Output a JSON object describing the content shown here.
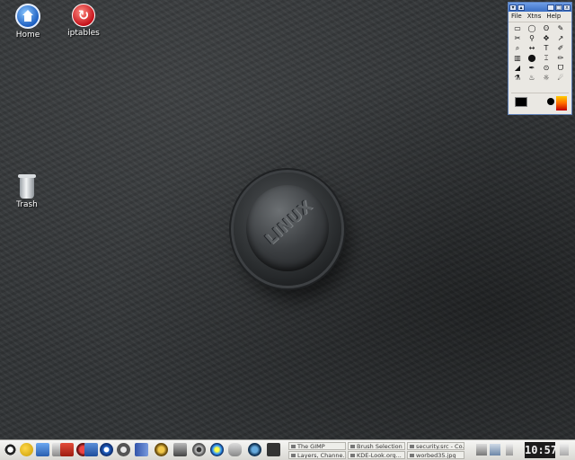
{
  "desktop": {
    "icons": [
      {
        "label": "Home"
      },
      {
        "label": "iptables"
      },
      {
        "label": "Trash"
      }
    ],
    "logo_text": "LINUX"
  },
  "gimp_toolbox": {
    "menu": [
      "File",
      "Xtns",
      "Help"
    ],
    "tools": [
      "▭",
      "◯",
      "ʘ",
      "✎",
      "✂",
      "⚲",
      "✥",
      "↗",
      "⌕",
      "↔",
      "T",
      "✐",
      "▥",
      "⬤",
      "⌶",
      "✏",
      "◢",
      "✒",
      "⊙",
      "ᗜ",
      "⚗",
      "♨",
      "☼",
      "☄"
    ],
    "colors": {
      "foreground": "#000000",
      "background": "#ffffff"
    }
  },
  "taskbar": {
    "tasks": [
      {
        "label": "The GIMP"
      },
      {
        "label": "Layers, Channe..."
      },
      {
        "label": "Brush Selection"
      },
      {
        "label": "KDE-Look.org..."
      },
      {
        "label": "security.src - Co..."
      },
      {
        "label": "worbed35.jpg"
      }
    ],
    "clock": "10:57"
  }
}
